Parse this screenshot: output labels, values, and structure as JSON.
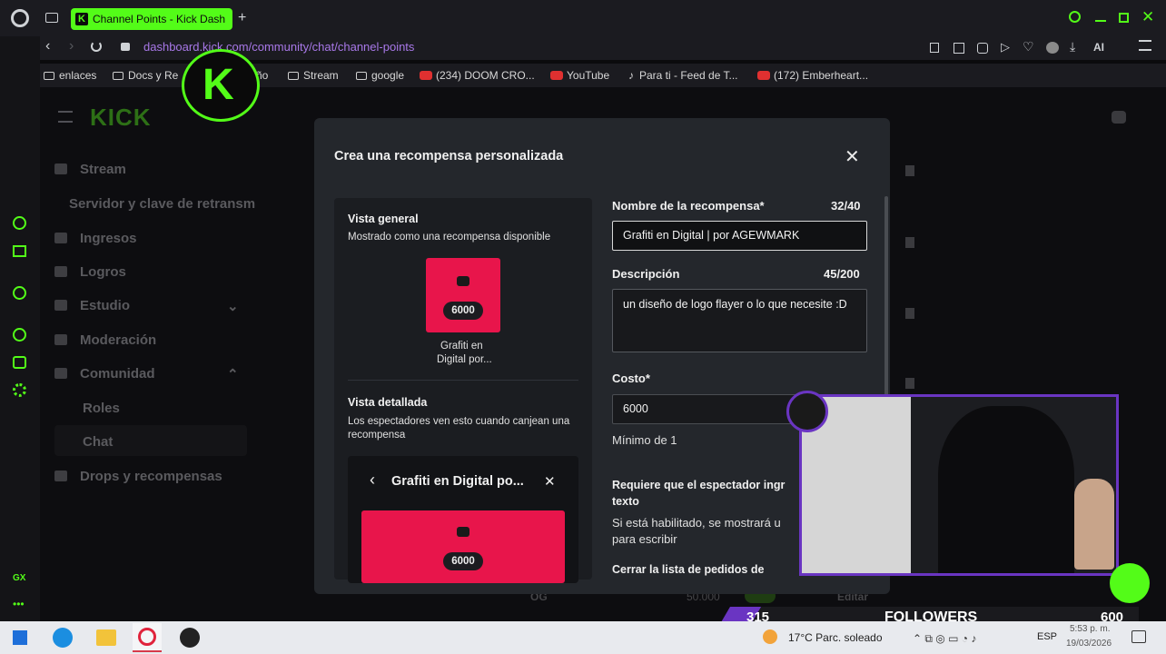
{
  "browser": {
    "tab_title": "Channel Points - Kick Dash",
    "url": "dashboard.kick.com/community/chat/channel-points",
    "ai_label": "AI",
    "bookmarks": [
      "enlaces",
      "Docs y Re",
      "ño",
      "Stream",
      "google",
      "(234) DOOM CRO...",
      "YouTube",
      "Para ti - Feed de T...",
      "(172) Emberheart..."
    ],
    "gx_label": "GX"
  },
  "dashboard": {
    "sidebar": [
      {
        "label": "Stream"
      },
      {
        "label": "Servidor y clave de retransm"
      },
      {
        "label": "Ingresos"
      },
      {
        "label": "Logros"
      },
      {
        "label": "Estudio"
      },
      {
        "label": "Moderación"
      },
      {
        "label": "Comunidad"
      },
      {
        "label": "Roles"
      },
      {
        "label": "Chat"
      },
      {
        "label": "Drops y recompensas"
      }
    ],
    "bg_row": {
      "name": "OG",
      "cost": "50.000",
      "action": "Editar"
    }
  },
  "modal": {
    "title": "Crea una recompensa personalizada",
    "overview_title": "Vista general",
    "overview_sub": "Mostrado como una recompensa disponible",
    "card_cost": "6000",
    "card_name_line1": "Grafiti en",
    "card_name_line2": "Digital por...",
    "detail_title": "Vista detallada",
    "detail_sub": "Los espectadores ven esto cuando canjean una recompensa",
    "detail_header": "Grafiti en Digital po...",
    "detail_cost": "6000",
    "form": {
      "name_label": "Nombre de la recompensa*",
      "name_count": "32/40",
      "name_value": "Grafiti en Digital | por AGEWMARK",
      "desc_label": "Descripción",
      "desc_count": "45/200",
      "desc_value": "un diseño de logo flayer o lo que necesite :D",
      "cost_label": "Costo*",
      "cost_value": "6000",
      "cost_hint": "Mínimo de 1",
      "req_text_label": "Requiere que el espectador ingr",
      "req_text_label2": "texto",
      "req_text_hint": "Si está habilitado, se mostrará u",
      "req_text_hint2": "para escribir",
      "close_list_label": "Cerrar la lista de pedidos de"
    }
  },
  "overlay": {
    "followers_current": "315",
    "followers_label": "FOLLOWERS",
    "followers_goal": "600"
  },
  "taskbar": {
    "weather": "17°C  Parc. soleado",
    "lang": "ESP",
    "time": "5:53 p. m.",
    "date": "19/03/2026"
  }
}
